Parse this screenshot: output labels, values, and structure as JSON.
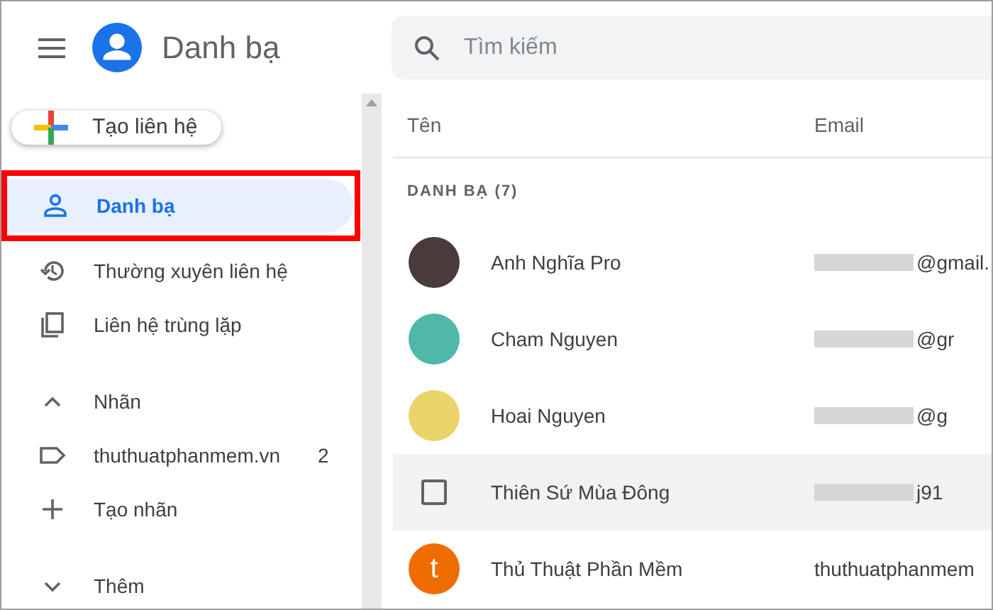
{
  "header": {
    "title": "Danh bạ"
  },
  "search": {
    "placeholder": "Tìm kiếm"
  },
  "create_button": {
    "label": "Tạo liên hệ"
  },
  "sidebar": {
    "items": [
      {
        "kind": "contacts",
        "label": "Danh bạ",
        "selected": true,
        "highlighted": true
      },
      {
        "kind": "history",
        "label": "Thường xuyên liên hệ",
        "selected": false,
        "highlighted": false
      },
      {
        "kind": "duplicate",
        "label": "Liên hệ trùng lặp",
        "selected": false,
        "highlighted": false
      }
    ],
    "labels_section": {
      "label": "Nhãn",
      "expanded": true,
      "items": [
        {
          "kind": "label",
          "label": "thuthuatphanmem.vn",
          "count": "2"
        },
        {
          "kind": "add",
          "label": "Tạo nhãn"
        }
      ]
    },
    "more_section": {
      "label": "Thêm",
      "expanded": false
    }
  },
  "table": {
    "columns": [
      "Tên",
      "Email"
    ],
    "group_label": "DANH BẠ (7)",
    "rows": [
      {
        "kind": "photo",
        "name": "Anh Nghĩa Pro",
        "email": "@gmail.",
        "email_blurred": true,
        "hovered": false
      },
      {
        "kind": "photo",
        "name": "Cham Nguyen",
        "email": "@gr",
        "email_blurred": true,
        "hovered": false
      },
      {
        "kind": "photo",
        "name": "Hoai Nguyen",
        "email": "@g",
        "email_blurred": true,
        "hovered": false
      },
      {
        "name": "Thiên Sứ Mùa Đông",
        "email": "j91",
        "email_blurred": true,
        "hovered": true
      },
      {
        "kind": "letter",
        "letter": "t",
        "color": "#ef6c00",
        "name": "Thủ Thuật Phần Mềm",
        "email": "thuthuatphanmem",
        "email_blurred": false,
        "hovered": false
      }
    ]
  }
}
